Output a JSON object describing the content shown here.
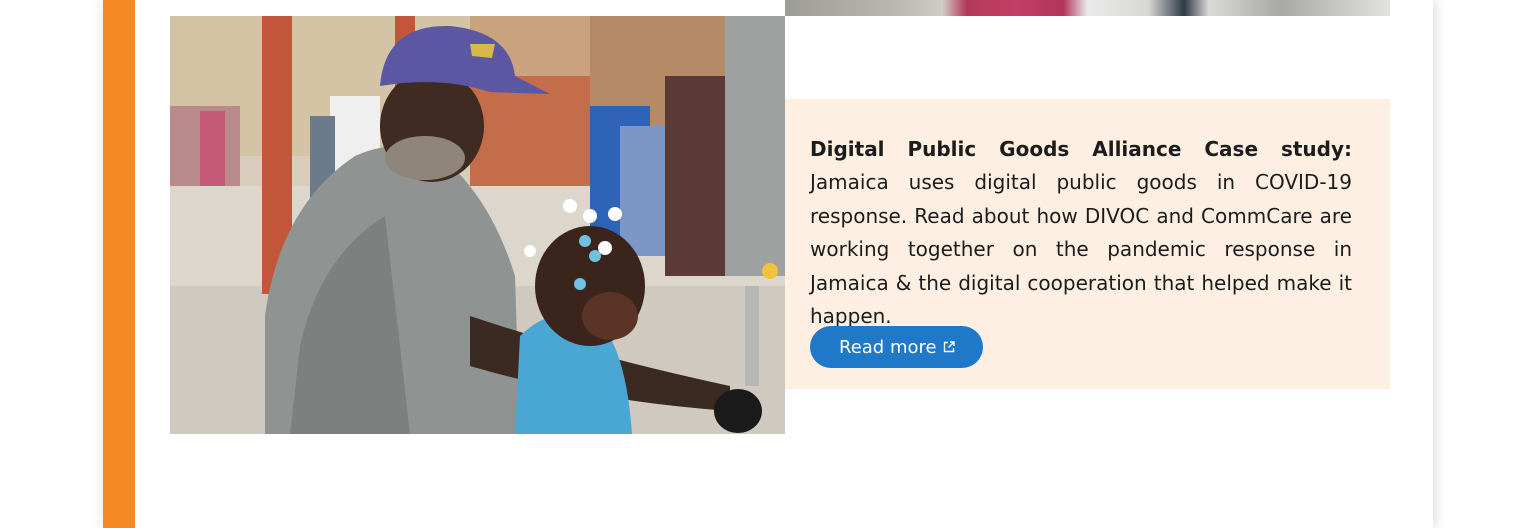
{
  "case_study": {
    "lead": "Digital Public Goods Alliance Case study:",
    "body": "Jamaica uses digital public goods in COVID-19 response. Read about how DIVOC and CommCare are working together on the pandemic response in Jamaica & the digital cooperation that helped make it happen.",
    "button_label": "Read more",
    "button_icon": "external-link-icon"
  },
  "photo": {
    "alt": ""
  },
  "colors": {
    "accent": "#f58a22",
    "panel_bg": "#fdf0e3",
    "button_bg": "#1f78c8"
  }
}
